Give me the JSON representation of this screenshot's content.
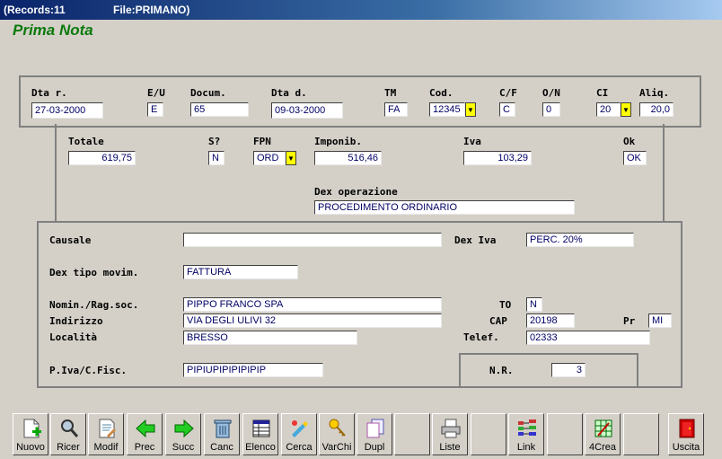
{
  "titlebar": {
    "records": "(Records:11",
    "file": "File:PRIMANO)"
  },
  "app_title": "Prima Nota",
  "row1": {
    "dta_r": {
      "label": "Dta r.",
      "value": "27-03-2000"
    },
    "eu": {
      "label": "E/U",
      "value": "E"
    },
    "docum": {
      "label": "Docum.",
      "value": "65"
    },
    "dta_d": {
      "label": "Dta d.",
      "value": "09-03-2000"
    },
    "tm": {
      "label": "TM",
      "value": "FA"
    },
    "cod": {
      "label": "Cod.",
      "value": "12345"
    },
    "cf": {
      "label": "C/F",
      "value": "C"
    },
    "on": {
      "label": "O/N",
      "value": "0"
    },
    "ci": {
      "label": "CI",
      "value": "20"
    },
    "aliq": {
      "label": "Aliq.",
      "value": "20,0"
    }
  },
  "row2": {
    "totale": {
      "label": "Totale",
      "value": "619,75"
    },
    "s": {
      "label": "S?",
      "value": "N"
    },
    "fpn": {
      "label": "FPN",
      "value": "ORD"
    },
    "imponib": {
      "label": "Imponib.",
      "value": "516,46"
    },
    "iva": {
      "label": "Iva",
      "value": "103,29"
    },
    "ok": {
      "label": "Ok",
      "value": "OK"
    },
    "dex_op": {
      "label": "Dex operazione",
      "value": "PROCEDIMENTO ORDINARIO"
    }
  },
  "anag": {
    "causale": {
      "label": "Causale",
      "value": ""
    },
    "dex_iva": {
      "label": "Dex Iva",
      "value": "PERC. 20%"
    },
    "dex_tipo": {
      "label": "Dex tipo movim.",
      "value": "FATTURA"
    },
    "nomin": {
      "label": "Nomin./Rag.soc.",
      "value": "PIPPO FRANCO SPA"
    },
    "to": {
      "label": "TO",
      "value": "N"
    },
    "indirizzo": {
      "label": "Indirizzo",
      "value": "VIA DEGLI ULIVI 32"
    },
    "cap": {
      "label": "CAP",
      "value": "20198"
    },
    "pr": {
      "label": "Pr",
      "value": "MI"
    },
    "localita": {
      "label": "Località",
      "value": "BRESSO"
    },
    "telef": {
      "label": "Telef.",
      "value": "02333"
    },
    "piva": {
      "label": "P.Iva/C.Fisc.",
      "value": "PIPIUPIPIPIPIPIP"
    },
    "nr": {
      "label": "N.R.",
      "value": "3"
    }
  },
  "toolbar": [
    {
      "label": "Nuovo",
      "icon": "new-document-icon"
    },
    {
      "label": "Ricer",
      "icon": "search-icon"
    },
    {
      "label": "Modif",
      "icon": "edit-icon"
    },
    {
      "label": "Prec",
      "icon": "arrow-left-icon"
    },
    {
      "label": "Succ",
      "icon": "arrow-right-icon"
    },
    {
      "label": "Canc",
      "icon": "trash-icon"
    },
    {
      "label": "Elenco",
      "icon": "list-icon"
    },
    {
      "label": "Cerca",
      "icon": "find-icon"
    },
    {
      "label": "VarChi",
      "icon": "keys-icon"
    },
    {
      "label": "Dupl",
      "icon": "duplicate-icon"
    },
    {
      "label": "",
      "icon": ""
    },
    {
      "label": "Liste",
      "icon": "printer-icon"
    },
    {
      "label": "",
      "icon": ""
    },
    {
      "label": "Link",
      "icon": "link-icon"
    },
    {
      "label": "",
      "icon": ""
    },
    {
      "label": "4Crea",
      "icon": "create-icon"
    },
    {
      "label": "",
      "icon": ""
    },
    {
      "label": "Uscita",
      "icon": "exit-door-icon"
    }
  ]
}
